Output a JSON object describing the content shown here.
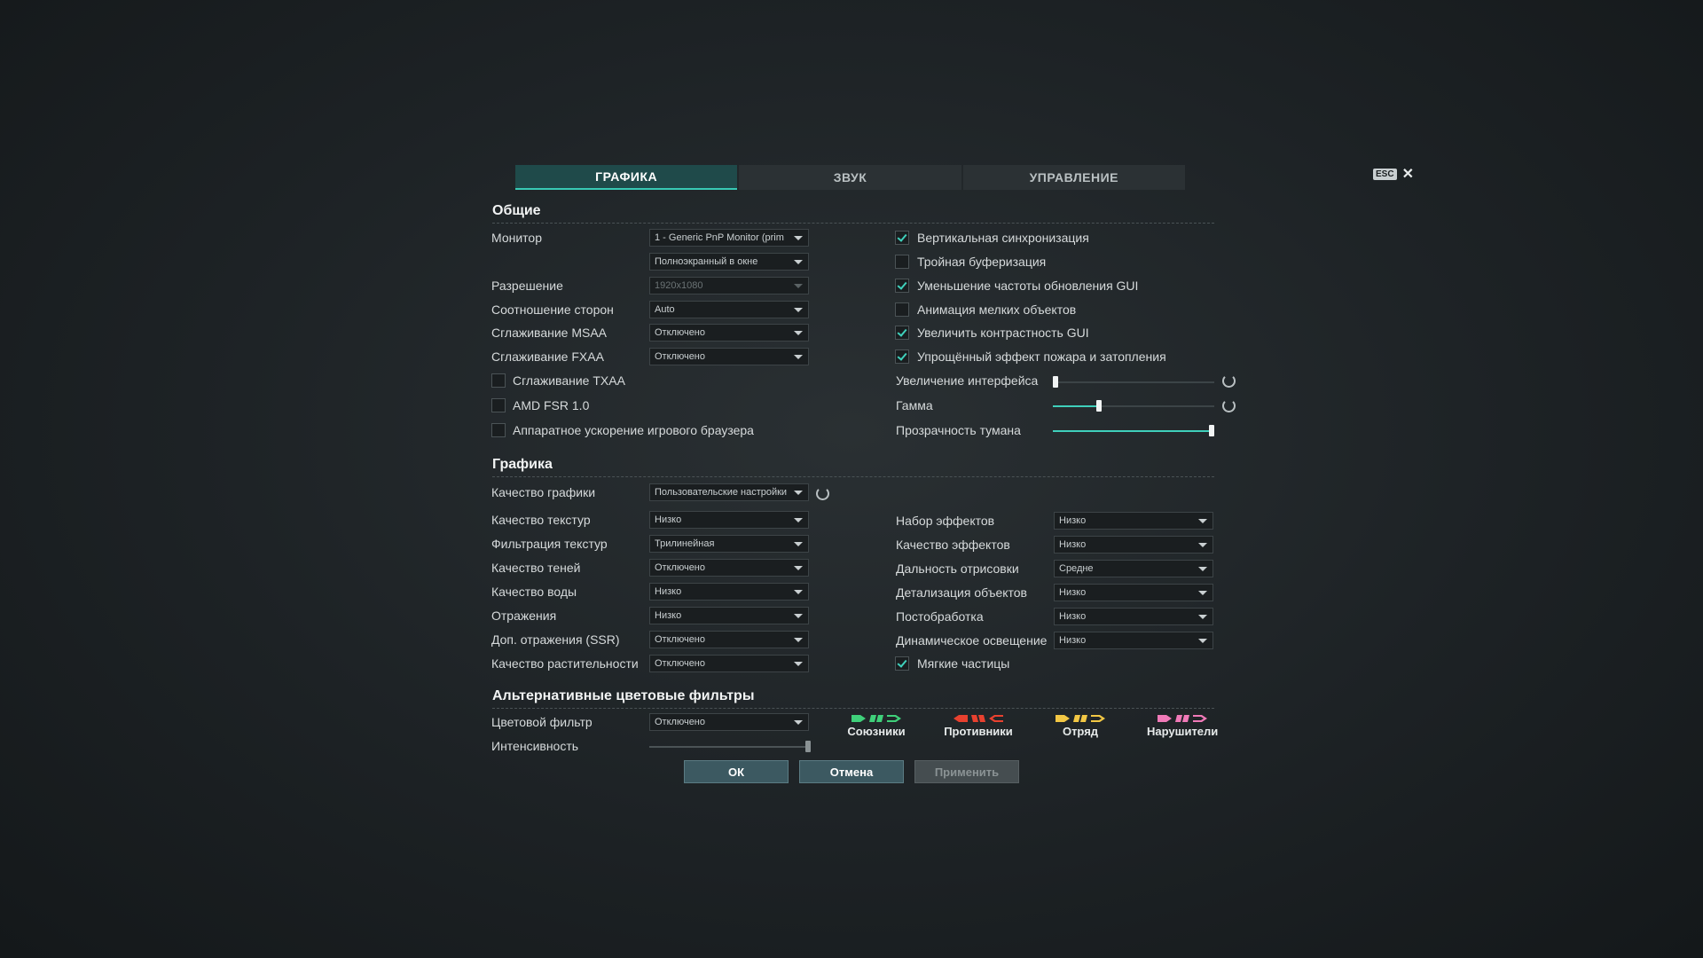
{
  "tabs": [
    {
      "label": "ГРАФИКА",
      "active": true
    },
    {
      "label": "ЗВУК",
      "active": false
    },
    {
      "label": "УПРАВЛЕНИЕ",
      "active": false
    }
  ],
  "close": {
    "key_label": "ESC",
    "icon": "close-icon"
  },
  "general": {
    "title": "Общие",
    "monitor_label": "Монитор",
    "monitor_value": "1 - Generic PnP Monitor (prim",
    "window_mode_value": "Полноэкранный в окне",
    "resolution_label": "Разрешение",
    "resolution_value": "1920x1080",
    "aspect_label": "Соотношение сторон",
    "aspect_value": "Auto",
    "msaa_label": "Сглаживание MSAA",
    "msaa_value": "Отключено",
    "fxaa_label": "Сглаживание FXAA",
    "fxaa_value": "Отключено",
    "left_checks": [
      {
        "label": "Сглаживание TXAA",
        "checked": false
      },
      {
        "label": "AMD FSR 1.0",
        "checked": false
      },
      {
        "label": "Аппаратное ускорение игрового браузера",
        "checked": false
      }
    ],
    "right_checks": [
      {
        "label": "Вертикальная синхронизация",
        "checked": true
      },
      {
        "label": "Тройная буферизация",
        "checked": false
      },
      {
        "label": "Уменьшение частоты обновления GUI",
        "checked": true
      },
      {
        "label": "Анимация мелких объектов",
        "checked": false
      },
      {
        "label": "Увеличить контрастность GUI",
        "checked": true
      },
      {
        "label": "Упрощённый эффект пожара и затопления",
        "checked": true
      }
    ],
    "sliders": [
      {
        "label": "Увеличение интерфейса",
        "value": 0.0,
        "reset": true
      },
      {
        "label": "Гамма",
        "value": 0.28,
        "reset": true
      },
      {
        "label": "Прозрачность тумана",
        "value": 1.0,
        "reset": false
      }
    ]
  },
  "graphics": {
    "title": "Графика",
    "quality_label": "Качество графики",
    "quality_value": "Пользовательские настройки",
    "left": [
      {
        "label": "Качество текстур",
        "value": "Низко"
      },
      {
        "label": "Фильтрация текстур",
        "value": "Трилинейная"
      },
      {
        "label": "Качество теней",
        "value": "Отключено"
      },
      {
        "label": "Качество воды",
        "value": "Низко"
      },
      {
        "label": "Отражения",
        "value": "Низко"
      },
      {
        "label": "Доп. отражения (SSR)",
        "value": "Отключено"
      },
      {
        "label": "Качество растительности",
        "value": "Отключено"
      }
    ],
    "right": [
      {
        "label": "Набор эффектов",
        "value": "Низко"
      },
      {
        "label": "Качество эффектов",
        "value": "Низко"
      },
      {
        "label": "Дальность отрисовки",
        "value": "Средне"
      },
      {
        "label": "Детализация объектов",
        "value": "Низко"
      },
      {
        "label": "Постобработка",
        "value": "Низко"
      },
      {
        "label": "Динамическое освещение",
        "value": "Низко"
      }
    ],
    "soft_particles": {
      "label": "Мягкие частицы",
      "checked": true
    }
  },
  "color_filters": {
    "title": "Альтернативные цветовые фильтры",
    "filter_label": "Цветовой фильтр",
    "filter_value": "Отключено",
    "intensity_label": "Интенсивность",
    "intensity_value": 1.0,
    "teams": [
      {
        "name": "Союзники",
        "color": "#3fd07a"
      },
      {
        "name": "Противники",
        "color": "#e8412f"
      },
      {
        "name": "Отряд",
        "color": "#f2c744"
      },
      {
        "name": "Нарушители",
        "color": "#f07ab8"
      }
    ]
  },
  "buttons": {
    "ok": "ОК",
    "cancel": "Отмена",
    "apply": "Применить"
  }
}
